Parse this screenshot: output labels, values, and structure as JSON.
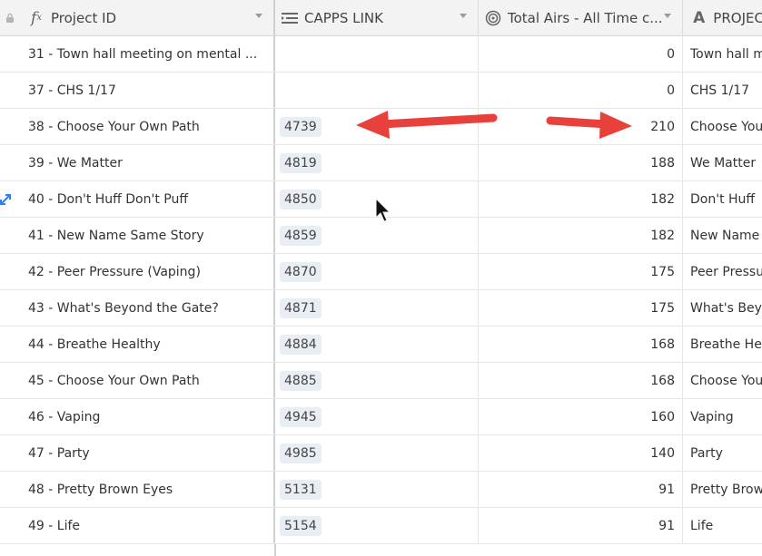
{
  "columns": [
    {
      "label": "Project ID",
      "icon": "formula-icon"
    },
    {
      "label": "CAPPS LINK",
      "icon": "lookup-icon"
    },
    {
      "label": "Total Airs - All Time c...",
      "icon": "rollup-icon"
    },
    {
      "label": "PROJEC",
      "icon": "text-field-icon"
    }
  ],
  "rows": [
    {
      "id": "31 - Town hall meeting on mental ...",
      "capps": "",
      "airs": "0",
      "project": "Town hall m"
    },
    {
      "id": "37 - CHS 1/17",
      "capps": "",
      "airs": "0",
      "project": "CHS 1/17"
    },
    {
      "id": "38 - Choose Your Own Path",
      "capps": "4739",
      "airs": "210",
      "project": "Choose You"
    },
    {
      "id": "39 - We Matter",
      "capps": "4819",
      "airs": "188",
      "project": "We Matter"
    },
    {
      "id": "40 - Don't Huff Don't Puff",
      "capps": "4850",
      "airs": "182",
      "project": "Don't Huff"
    },
    {
      "id": "41 - New Name Same Story",
      "capps": "4859",
      "airs": "182",
      "project": "New Name"
    },
    {
      "id": "42 - Peer Pressure (Vaping)",
      "capps": "4870",
      "airs": "175",
      "project": "Peer Pressu"
    },
    {
      "id": "43 - What's Beyond the Gate?",
      "capps": "4871",
      "airs": "175",
      "project": "What's Bey"
    },
    {
      "id": "44 - Breathe Healthy",
      "capps": "4884",
      "airs": "168",
      "project": "Breathe He"
    },
    {
      "id": "45 - Choose Your Own Path",
      "capps": "4885",
      "airs": "168",
      "project": "Choose You"
    },
    {
      "id": "46 - Vaping",
      "capps": "4945",
      "airs": "160",
      "project": "Vaping"
    },
    {
      "id": "47 - Party",
      "capps": "4985",
      "airs": "140",
      "project": "Party"
    },
    {
      "id": "48 - Pretty Brown Eyes",
      "capps": "5131",
      "airs": "91",
      "project": "Pretty Brow"
    },
    {
      "id": "49 - Life",
      "capps": "5154",
      "airs": "91",
      "project": "Life"
    }
  ],
  "colors": {
    "arrow": "#e8413c",
    "chip": "#e9eef5",
    "expand": "#2d7ff9"
  }
}
